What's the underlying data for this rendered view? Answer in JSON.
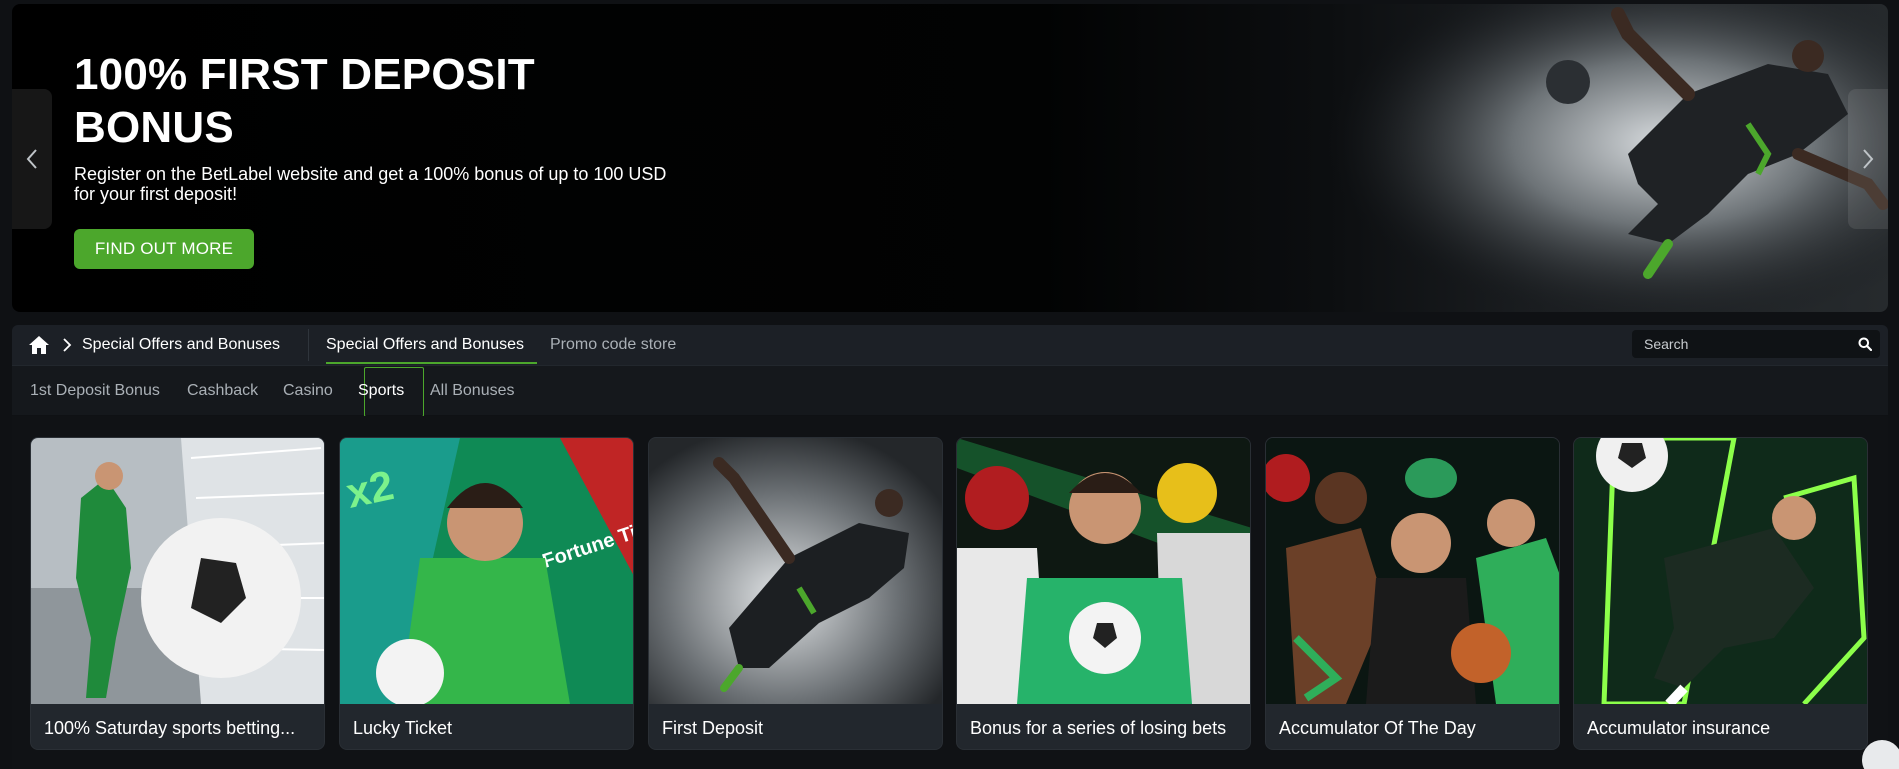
{
  "hero": {
    "title": "100% FIRST DEPOSIT BONUS",
    "description": "Register on the BetLabel website and get a 100% bonus of up to 100 USD for your first deposit!",
    "cta": "FIND OUT MORE",
    "prev_icon": "chevron-left-icon",
    "next_icon": "chevron-right-icon"
  },
  "breadcrumb": {
    "home_icon": "home-icon",
    "current": "Special Offers and Bonuses"
  },
  "nav": {
    "tabs": [
      {
        "label": "Special Offers and Bonuses",
        "active": true
      },
      {
        "label": "Promo code store",
        "active": false
      }
    ]
  },
  "search": {
    "placeholder": "Search",
    "icon": "search-icon"
  },
  "filters": [
    {
      "label": "1st Deposit Bonus",
      "selected": false
    },
    {
      "label": "Cashback",
      "selected": false
    },
    {
      "label": "Casino",
      "selected": false
    },
    {
      "label": "Sports",
      "selected": true
    },
    {
      "label": "All Bonuses",
      "selected": false
    }
  ],
  "cards": [
    {
      "title": "100% Saturday sports betting..."
    },
    {
      "title": "Lucky Ticket"
    },
    {
      "title": "First Deposit"
    },
    {
      "title": "Bonus for a series of losing bets"
    },
    {
      "title": "Accumulator Of The Day"
    },
    {
      "title": "Accumulator insurance"
    }
  ],
  "card_art_labels": {
    "lucky_ticket_x2": "x2",
    "lucky_ticket_brand": "Fortune Ticket"
  },
  "colors": {
    "accent": "#4ca72c",
    "background": "#0f1114",
    "panel": "#1c2026",
    "card": "#22272d"
  }
}
